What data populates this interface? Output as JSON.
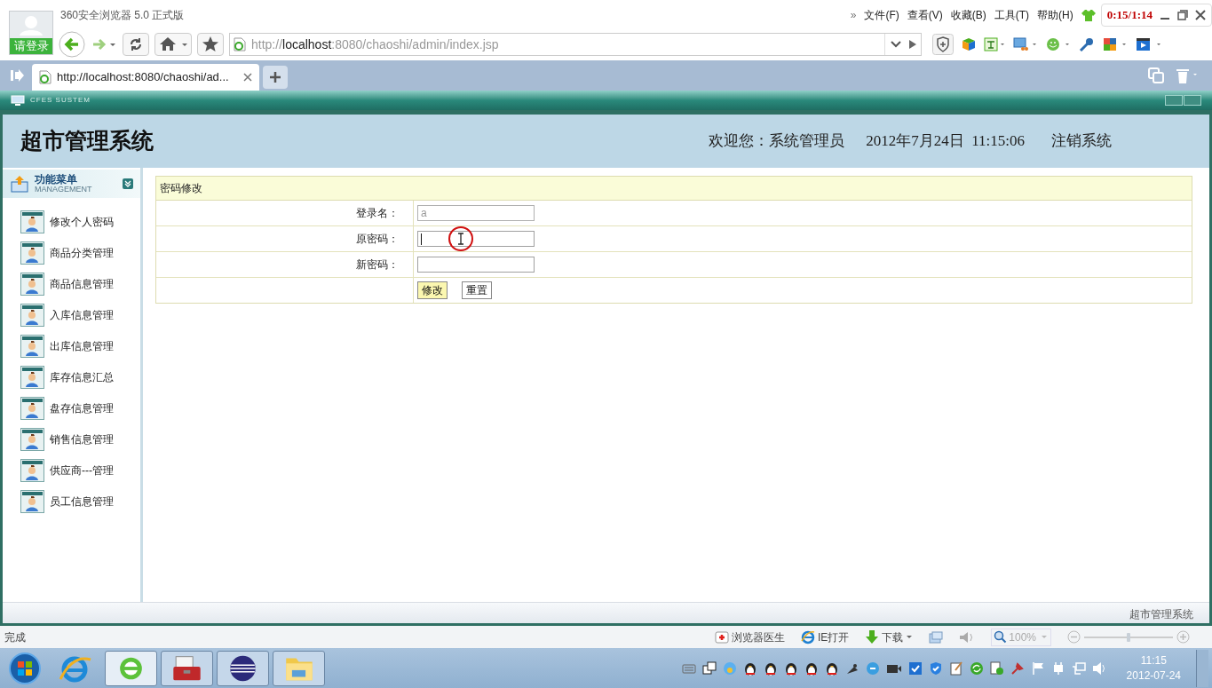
{
  "browser": {
    "title": "360安全浏览器 5.0 正式版",
    "login_label": "请登录",
    "menu_chevron": "»",
    "menu": [
      "文件(F)",
      "查看(V)",
      "收藏(B)",
      "工具(T)",
      "帮助(H)"
    ],
    "recorder_timer": "0:15/1:14",
    "address": {
      "scheme": "http://",
      "host": "localhost",
      "rest": ":8080/chaoshi/admin/index.jsp"
    },
    "tabs": [
      {
        "label": "http://localhost:8080/chaoshi/ad...",
        "selected": true
      }
    ]
  },
  "app": {
    "bar_title": "CFES SUSTEM",
    "title": "超市管理系统",
    "welcome": "欢迎您：系统管理员",
    "datetime": "2012年7月24日  11:15:06",
    "logout": "注销系统",
    "menu_title": "功能菜单",
    "menu_subtitle": "MANAGEMENT",
    "menu_items": [
      "修改个人密码",
      "商品分类管理",
      "商品信息管理",
      "入库信息管理",
      "出库信息管理",
      "库存信息汇总",
      "盘存信息管理",
      "销售信息管理",
      "供应商---管理",
      "员工信息管理"
    ],
    "form": {
      "title": "密码修改",
      "fields": [
        {
          "label": "登录名：",
          "value": "a",
          "disabled": true,
          "focused": false
        },
        {
          "label": "原密码：",
          "disabled": false,
          "focused": true
        },
        {
          "label": "新密码：",
          "disabled": false,
          "focused": false
        }
      ],
      "buttons": [
        {
          "label": "修改",
          "primary": true
        },
        {
          "label": "重置",
          "primary": false
        }
      ]
    },
    "footer": "超市管理系统"
  },
  "status_bar": {
    "text": "完成",
    "items": [
      {
        "kind": "doctor",
        "label": "浏览器医生"
      },
      {
        "kind": "ie",
        "label": "IE打开"
      },
      {
        "kind": "download",
        "label": "下载"
      }
    ],
    "zoom": "100%",
    "zoom_slider": {
      "level": 0.5
    }
  },
  "taskbar": {
    "time": "11:15",
    "date": "2012-07-24"
  }
}
